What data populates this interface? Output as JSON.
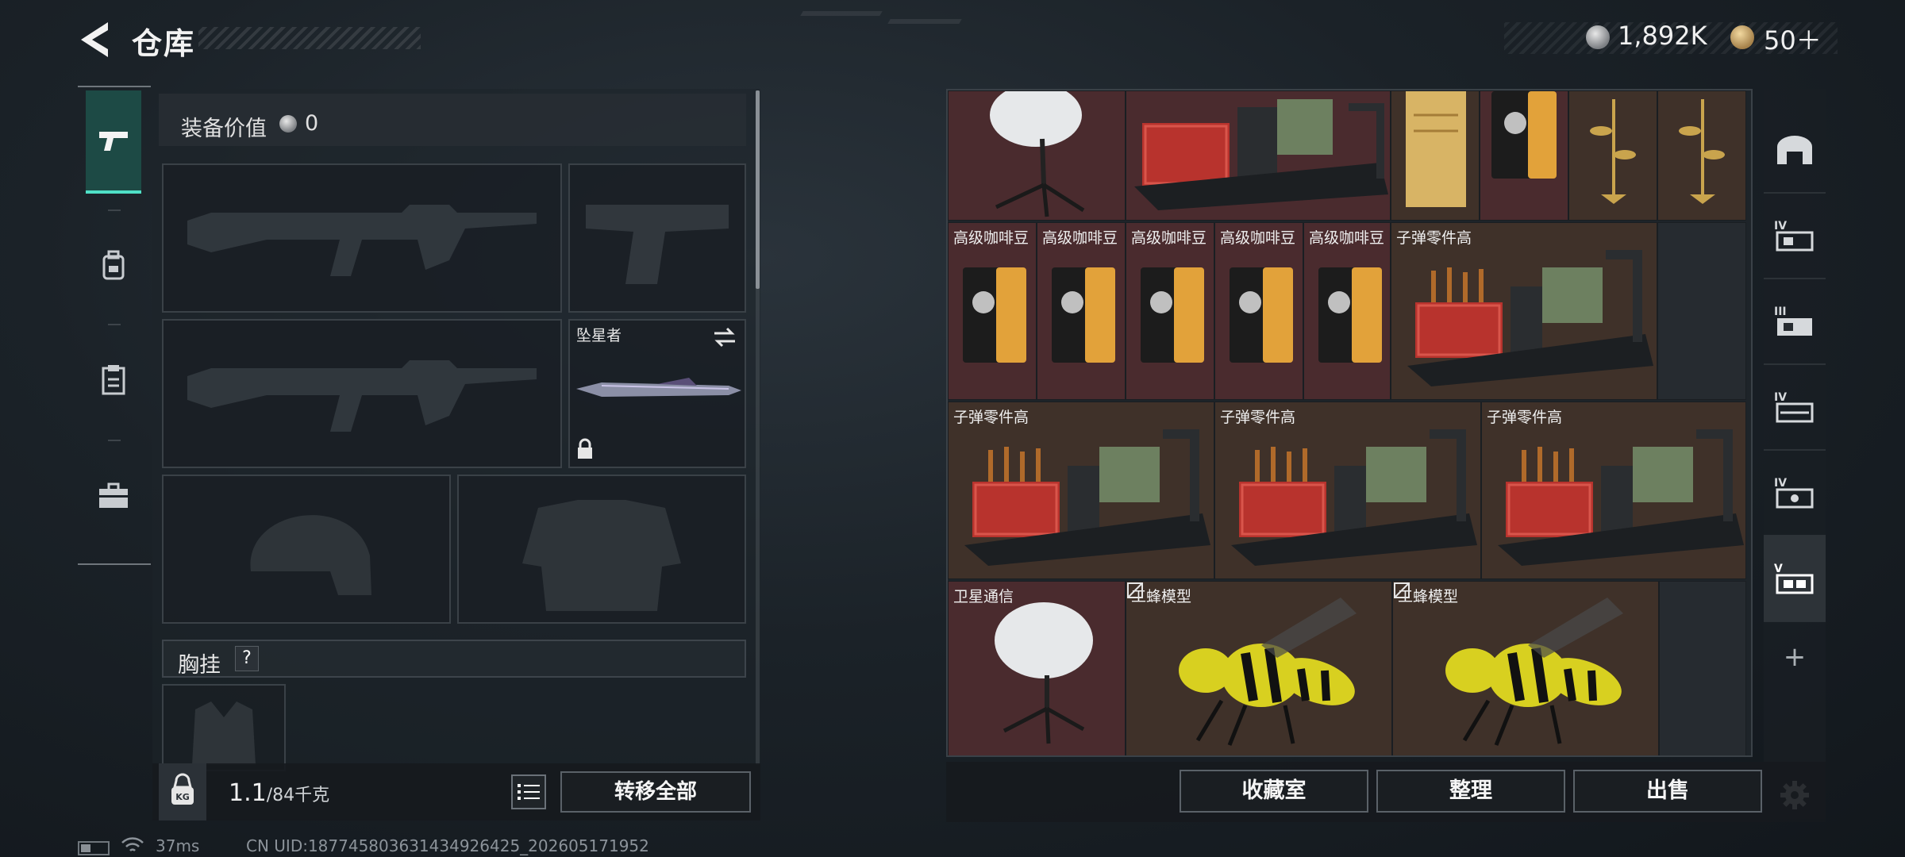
{
  "header": {
    "title": "仓库",
    "currency_silver": "1,892K",
    "currency_gold": "50＋"
  },
  "left_rail": {
    "tabs": [
      {
        "icon": "pistol-icon",
        "active": true
      },
      {
        "icon": "backpack-icon",
        "active": false
      },
      {
        "icon": "clipboard-icon",
        "active": false
      },
      {
        "icon": "briefcase-icon",
        "active": false
      }
    ]
  },
  "equipment": {
    "value_label": "装备价值",
    "value": "0",
    "melee_name": "坠星者",
    "chest_label": "胸挂",
    "chest_help": "?"
  },
  "weight": {
    "current": "1.1",
    "capacity": "/84千克",
    "kg_label": "KG"
  },
  "actions": {
    "transfer_all": "转移全部",
    "collection_room": "收藏室",
    "organize": "整理",
    "sell": "出售"
  },
  "status": {
    "ping": "37ms",
    "uid": "CN UID:18774580363143492642​5_202605171952"
  },
  "stash": {
    "items": [
      {
        "name": "",
        "item": "satellite-dish"
      },
      {
        "name": "",
        "item": "bullet-parts-crate"
      },
      {
        "name": "",
        "item": "document"
      },
      {
        "name": "",
        "item": "coffee-bag"
      },
      {
        "name": "",
        "item": "golden-rose"
      },
      {
        "name": "",
        "item": "golden-rose"
      },
      {
        "name": "高级咖啡豆",
        "item": "coffee-bag"
      },
      {
        "name": "高级咖啡豆",
        "item": "coffee-bag"
      },
      {
        "name": "高级咖啡豆",
        "item": "coffee-bag"
      },
      {
        "name": "高级咖啡豆",
        "item": "coffee-bag"
      },
      {
        "name": "高级咖啡豆",
        "item": "coffee-bag"
      },
      {
        "name": "子弹零件高",
        "item": "bullet-parts-crate"
      },
      {
        "name": "子弹零件高",
        "item": "bullet-parts-crate"
      },
      {
        "name": "子弹零件高",
        "item": "bullet-parts-crate"
      },
      {
        "name": "子弹零件高",
        "item": "bullet-parts-crate"
      },
      {
        "name": "卫星通信",
        "item": "satellite-dish"
      },
      {
        "name": "工蜂模型",
        "item": "wasp-model"
      },
      {
        "name": "工蜂模型",
        "item": "wasp-model"
      }
    ]
  },
  "right_rail": {
    "items": [
      {
        "icon": "armory-icon",
        "label": ""
      },
      {
        "icon": "stash-tier-icon",
        "label": "IV"
      },
      {
        "icon": "stash-tier-icon",
        "label": "III"
      },
      {
        "icon": "stash-tier-icon",
        "label": "IV"
      },
      {
        "icon": "stash-tier-icon",
        "label": "IV"
      },
      {
        "icon": "stash-tier-icon",
        "label": "V"
      }
    ],
    "add": "+"
  },
  "colors": {
    "accent": "#4fe0c6",
    "cell_red": "#4a2b2e",
    "cell_brown": "#3f3129"
  }
}
